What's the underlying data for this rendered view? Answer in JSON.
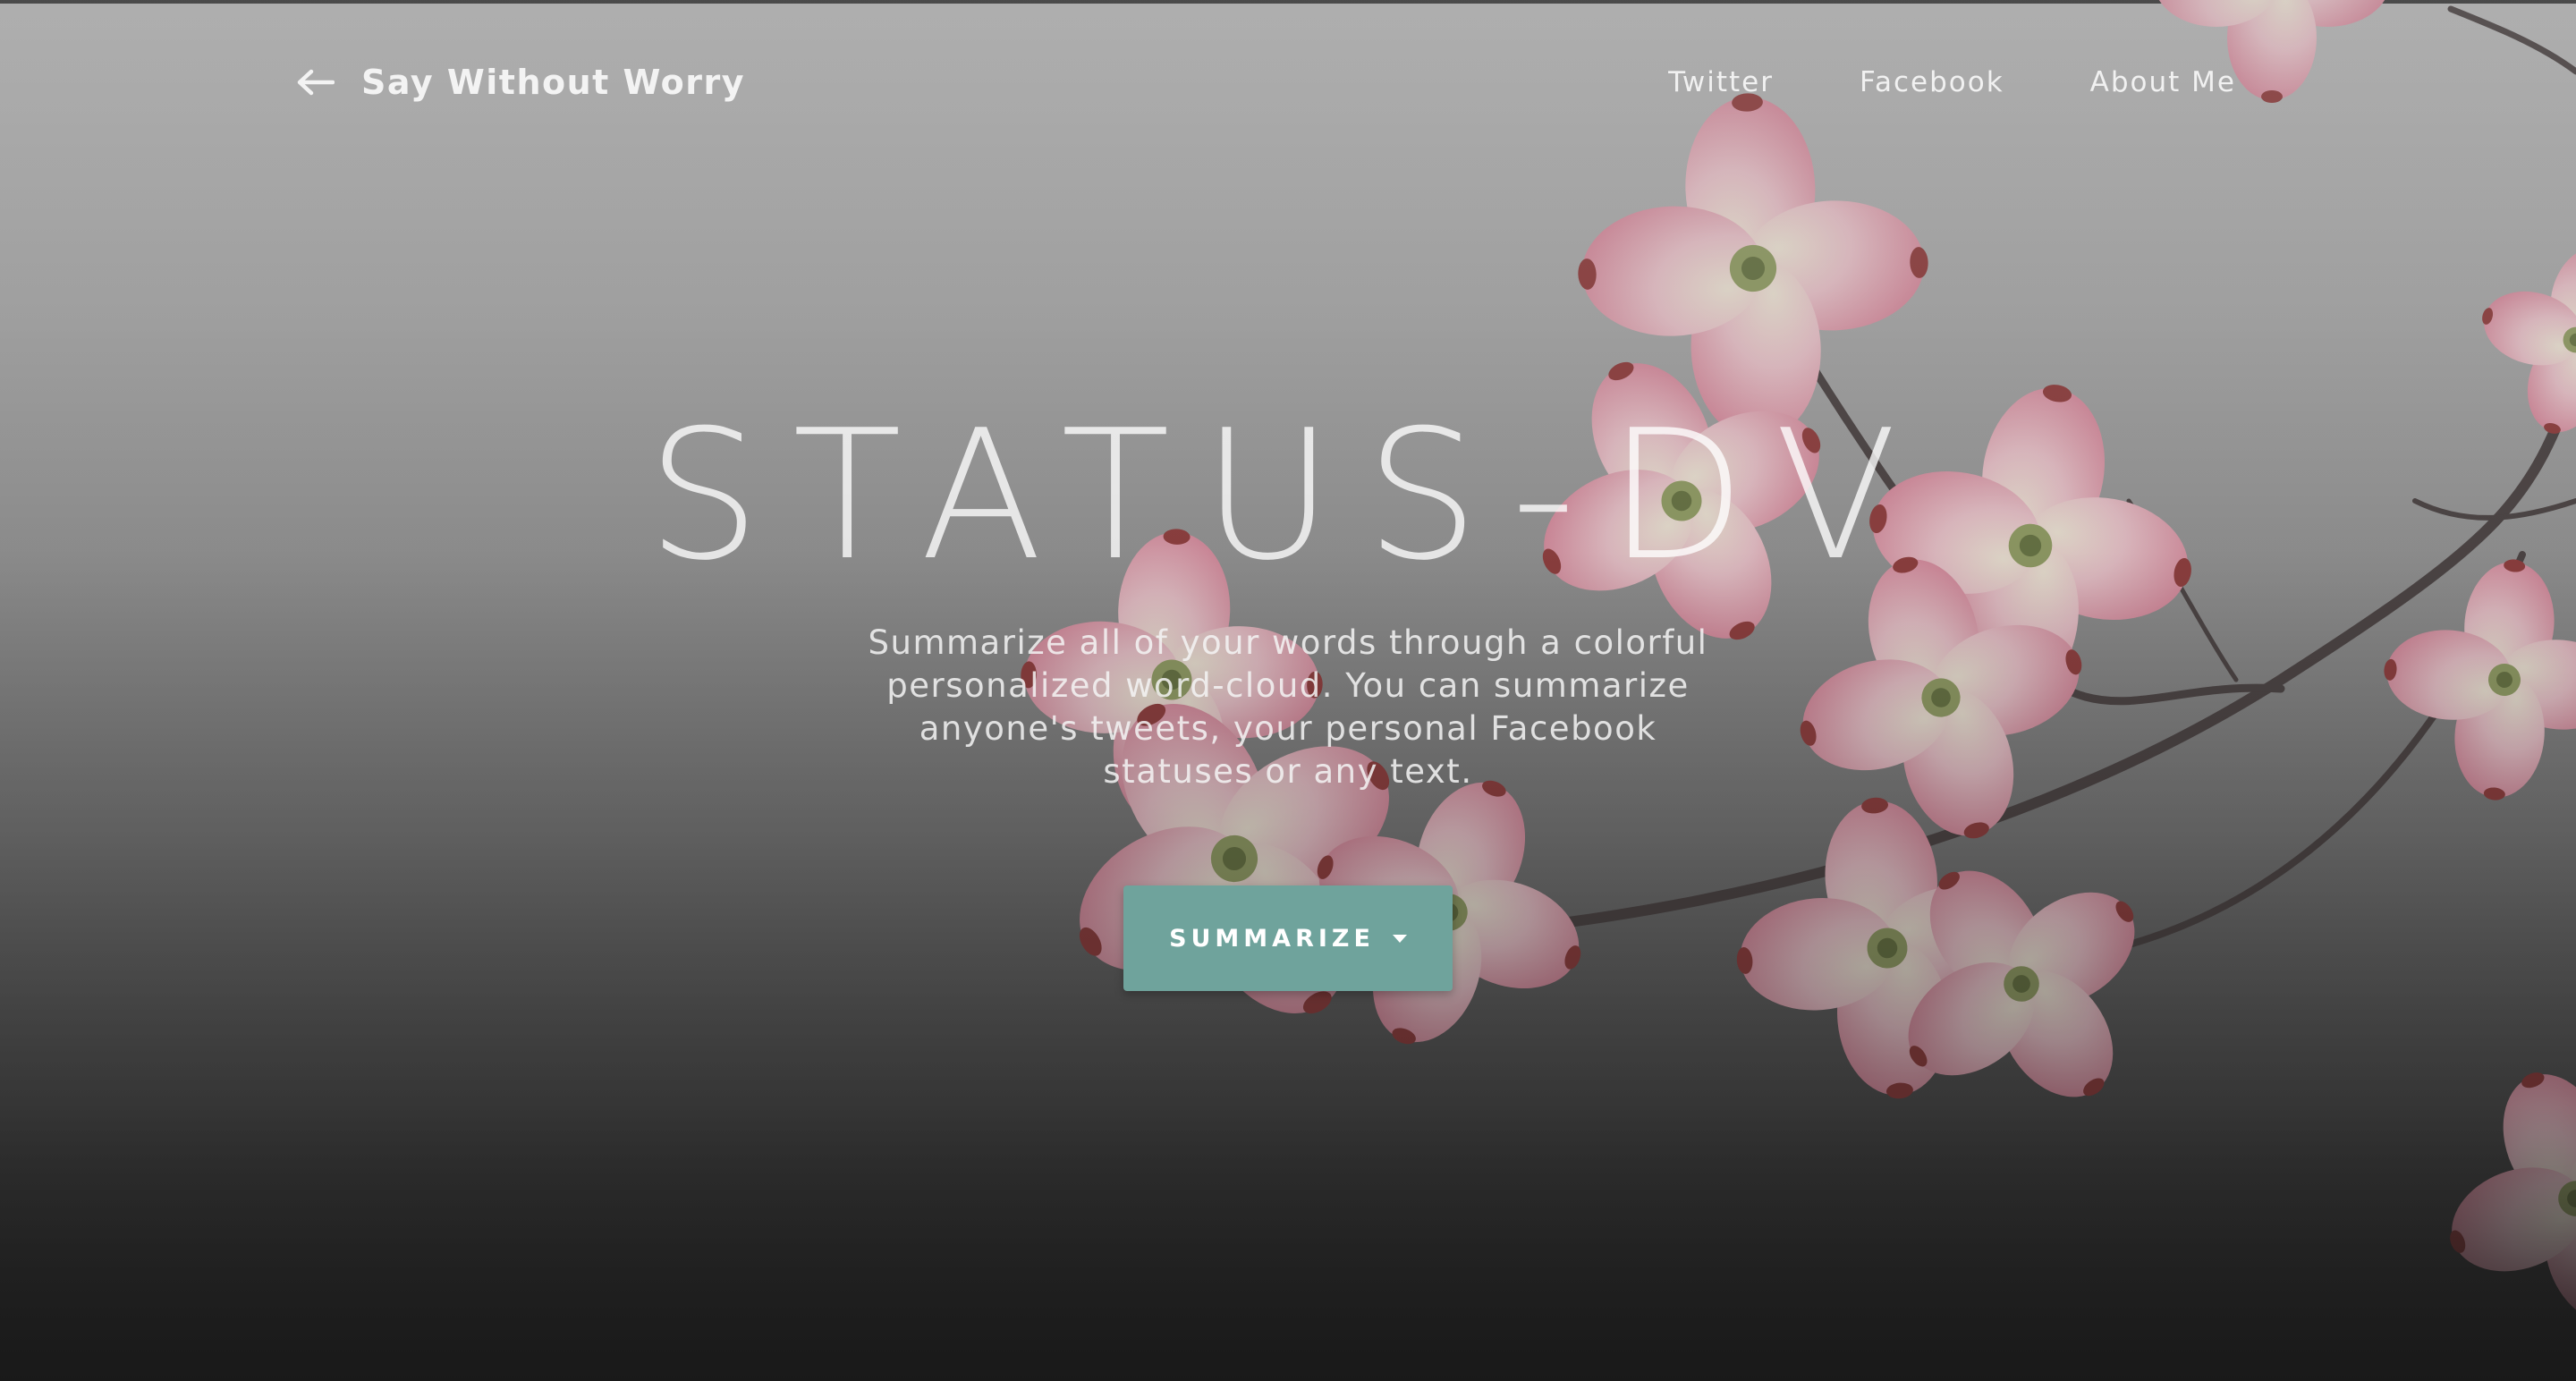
{
  "navbar": {
    "brand": "Say Without Worry",
    "back_icon": "arrow-left-icon",
    "links": [
      "Twitter",
      "Facebook",
      "About Me"
    ]
  },
  "hero": {
    "title": "STATUS-DV",
    "subtitle": "Summarize all of your words through a colorful personalized word-cloud. You can summarize anyone's tweets, your personal Facebook statuses or any text.",
    "cta_label": "SUMMARIZE",
    "cta_icon": "caret-down-icon"
  },
  "colors": {
    "accent": "#6fa39c",
    "blossom": "#e8a7b5",
    "branch": "#3e3535"
  }
}
